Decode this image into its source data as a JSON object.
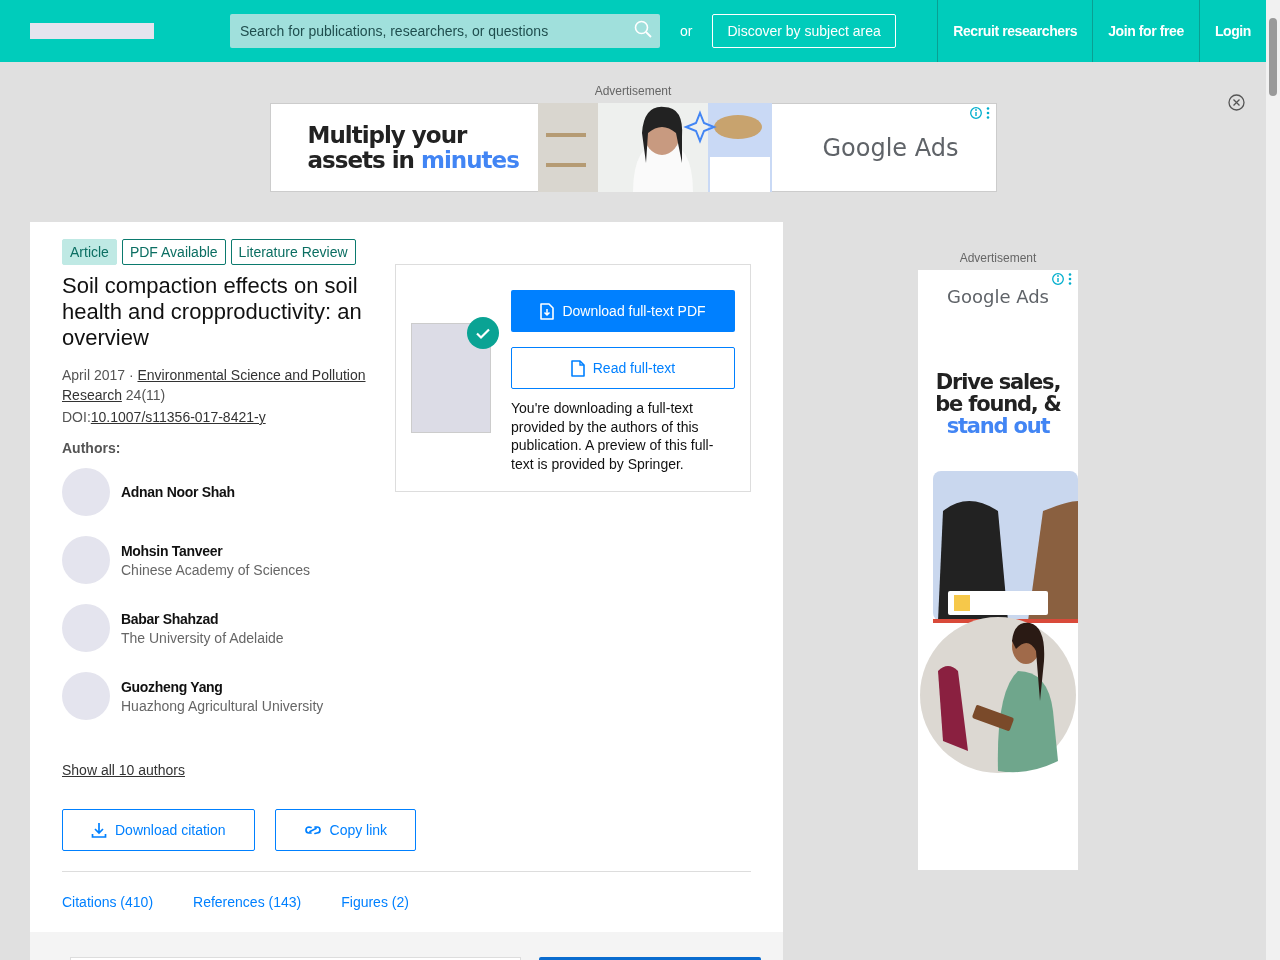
{
  "header": {
    "search_placeholder": "Search for publications, researchers, or questions",
    "or": "or",
    "discover": "Discover by subject area",
    "nav": [
      "Recruit researchers",
      "Join for free",
      "Login"
    ]
  },
  "top_ad": {
    "label": "Advertisement",
    "headline": "Multiply your assets in",
    "accent": "minutes",
    "brand": "Google Ads"
  },
  "article": {
    "badges": [
      {
        "label": "Article",
        "kind": "type"
      },
      {
        "label": "PDF Available",
        "kind": "tag"
      },
      {
        "label": "Literature Review",
        "kind": "tag"
      }
    ],
    "title": "Soil compaction effects on soil health and cropproductivity: an overview",
    "date": "April 2017 · ",
    "journal": [
      "Environmental Science and Pollution",
      "Research"
    ],
    "issue": " 24(11)",
    "doi_label": "DOI:",
    "doi": "10.1007/s11356-017-8421-y",
    "authors_label": "Authors:",
    "authors": [
      {
        "name": "Adnan Noor Shah"
      },
      {
        "name": "Mohsin Tanveer",
        "affiliation": "Chinese Academy of Sciences"
      },
      {
        "name": "Babar Shahzad",
        "affiliation": "The University of Adelaide"
      },
      {
        "name": "Guozheng Yang",
        "affiliation": "Huazhong Agricultural University"
      }
    ],
    "show_all": "Show all 10 authors",
    "actions": [
      {
        "label": "Download citation",
        "kind": "download"
      },
      {
        "label": "Copy link",
        "kind": "link"
      }
    ],
    "tabs": [
      {
        "label": "Citations (410)",
        "selected": false
      },
      {
        "label": "References (143)",
        "selected": false
      },
      {
        "label": "Figures (2)",
        "selected": false
      }
    ]
  },
  "download": {
    "primary": "Download full-text PDF",
    "secondary": "Read full-text",
    "note": "You're downloading a full-text provided by the authors of this publication. A preview of this full-text is provided by Springer."
  },
  "side_ad": {
    "label": "Advertisement",
    "brand": "Google Ads",
    "headline": "Drive sales, be found, &",
    "accent": "stand out"
  }
}
